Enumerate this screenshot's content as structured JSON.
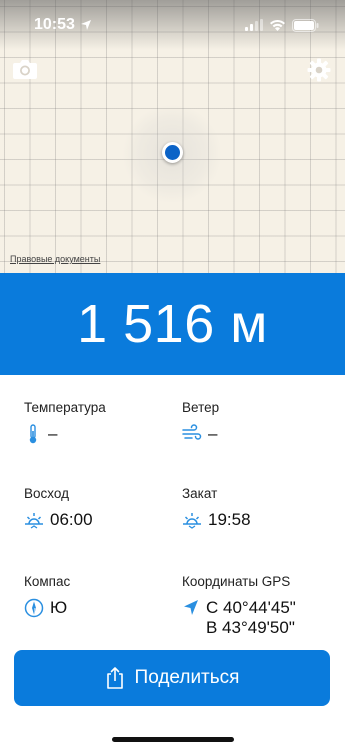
{
  "status_bar": {
    "time": "10:53"
  },
  "map": {
    "legal_link": "Правовые документы"
  },
  "altitude": {
    "value": "1 516 м"
  },
  "info": {
    "temperature": {
      "label": "Температура",
      "value": "–"
    },
    "wind": {
      "label": "Ветер",
      "value": "–"
    },
    "sunrise": {
      "label": "Восход",
      "value": "06:00"
    },
    "sunset": {
      "label": "Закат",
      "value": "19:58"
    },
    "compass": {
      "label": "Компас",
      "value": "Ю"
    },
    "gps": {
      "label": "Координаты GPS",
      "lat": "С 40°44'45\"",
      "lon": "В 43°49'50\""
    }
  },
  "share_button": {
    "label": "Поделиться"
  },
  "colors": {
    "accent": "#0a7bdc",
    "location_dot": "#0b63c7",
    "icon_blue": "#2a8fe0",
    "map_bg": "#f6f1e6"
  },
  "icons": [
    "location-arrow-icon",
    "signal-icon",
    "wifi-icon",
    "battery-icon",
    "camera-icon",
    "gear-icon",
    "thermometer-icon",
    "wind-icon",
    "sunrise-icon",
    "sunset-icon",
    "compass-icon",
    "navigation-arrow-icon",
    "share-icon"
  ]
}
